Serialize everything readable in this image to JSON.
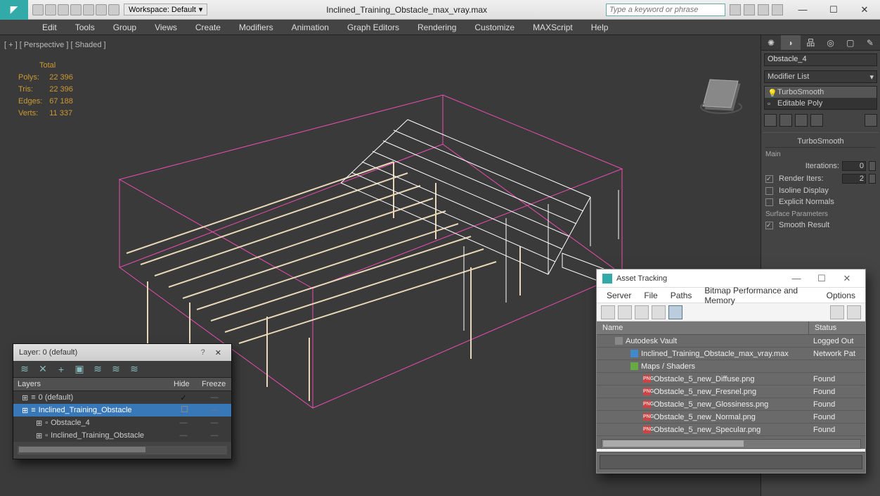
{
  "title": {
    "filename": "Inclined_Training_Obstacle_max_vray.max",
    "workspace_label": "Workspace: Default",
    "search_placeholder": "Type a keyword or phrase"
  },
  "menubar": [
    "Edit",
    "Tools",
    "Group",
    "Views",
    "Create",
    "Modifiers",
    "Animation",
    "Graph Editors",
    "Rendering",
    "Customize",
    "MAXScript",
    "Help"
  ],
  "viewport": {
    "label": "[ + ] [ Perspective ] [ Shaded ]",
    "stats_header": "Total",
    "stats": [
      {
        "label": "Polys:",
        "value": "22 396"
      },
      {
        "label": "Tris:",
        "value": "22 396"
      },
      {
        "label": "Edges:",
        "value": "67 188"
      },
      {
        "label": "Verts:",
        "value": "11 337"
      }
    ]
  },
  "cmdpanel": {
    "object_name": "Obstacle_4",
    "modlist_label": "Modifier List",
    "stack": [
      {
        "name": "TurboSmooth",
        "bulb": true
      },
      {
        "name": "Editable Poly",
        "bulb": false
      }
    ],
    "rollout_title": "TurboSmooth",
    "section_main": "Main",
    "iterations_label": "Iterations:",
    "iterations_val": "0",
    "render_iters_label": "Render Iters:",
    "render_iters_val": "2",
    "render_iters_checked": true,
    "isoline_label": "Isoline Display",
    "isoline_checked": false,
    "explicit_label": "Explicit Normals",
    "explicit_checked": false,
    "surface_section": "Surface Parameters",
    "smooth_result_label": "Smooth Result",
    "smooth_result_checked": true
  },
  "layerdlg": {
    "title": "Layer: 0 (default)",
    "cols": {
      "layers": "Layers",
      "hide": "Hide",
      "freeze": "Freeze"
    },
    "rows": [
      {
        "indent": 0,
        "name": "0 (default)",
        "sel": false,
        "hide": "check",
        "freeze": "dash",
        "type": "layer"
      },
      {
        "indent": 0,
        "name": "Inclined_Training_Obstacle",
        "sel": true,
        "hide": "box",
        "freeze": "dash",
        "type": "layer"
      },
      {
        "indent": 1,
        "name": "Obstacle_4",
        "sel": false,
        "hide": "dash",
        "freeze": "dash",
        "type": "obj"
      },
      {
        "indent": 1,
        "name": "Inclined_Training_Obstacle",
        "sel": false,
        "hide": "dash",
        "freeze": "dash",
        "type": "obj"
      }
    ]
  },
  "assetdlg": {
    "title": "Asset Tracking",
    "menu": [
      "Server",
      "File",
      "Paths",
      "Bitmap Performance and Memory",
      "Options"
    ],
    "cols": {
      "name": "Name",
      "status": "Status"
    },
    "rows": [
      {
        "indent": 1,
        "icon": "vault",
        "name": "Autodesk Vault",
        "status": "Logged Out"
      },
      {
        "indent": 2,
        "icon": "scene",
        "name": "Inclined_Training_Obstacle_max_vray.max",
        "status": "Network Pat"
      },
      {
        "indent": 2,
        "icon": "folder",
        "name": "Maps / Shaders",
        "status": ""
      },
      {
        "indent": 3,
        "icon": "png",
        "name": "Obstacle_5_new_Diffuse.png",
        "status": "Found"
      },
      {
        "indent": 3,
        "icon": "png",
        "name": "Obstacle_5_new_Fresnel.png",
        "status": "Found"
      },
      {
        "indent": 3,
        "icon": "png",
        "name": "Obstacle_5_new_Glossiness.png",
        "status": "Found"
      },
      {
        "indent": 3,
        "icon": "png",
        "name": "Obstacle_5_new_Normal.png",
        "status": "Found"
      },
      {
        "indent": 3,
        "icon": "png",
        "name": "Obstacle_5_new_Specular.png",
        "status": "Found"
      }
    ]
  }
}
